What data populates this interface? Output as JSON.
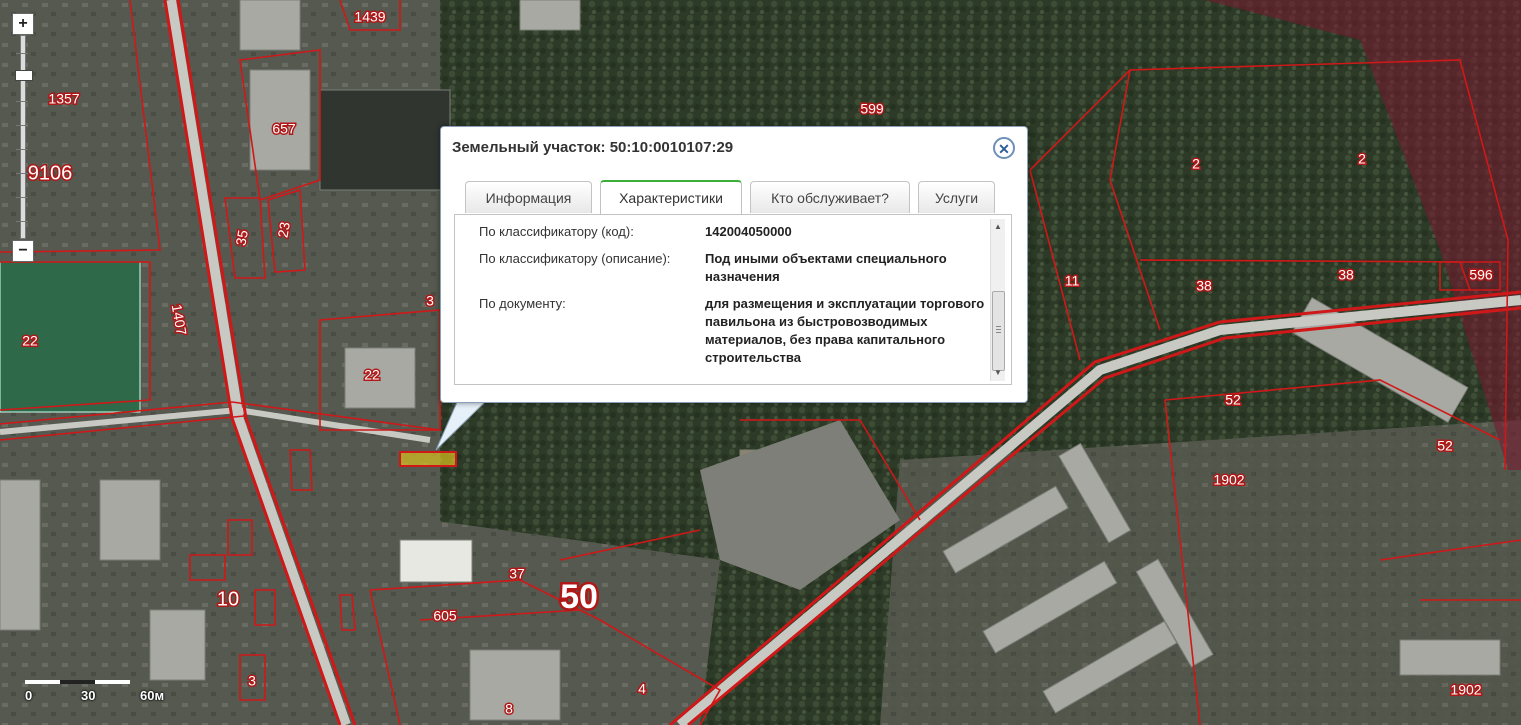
{
  "map": {
    "parcel_labels": [
      "1439",
      "1357",
      "657",
      "9106",
      "35",
      "23",
      "22",
      "1407",
      "3",
      "22",
      "599",
      "2",
      "2",
      "11",
      "38",
      "38",
      "596",
      "52",
      "52",
      "1902",
      "10",
      "37",
      "605",
      "4",
      "8",
      "1902"
    ],
    "district_label": "50",
    "parcel_outline_color": "#d01818",
    "highlight_color": "#e8d020"
  },
  "zoom": {
    "plus_label": "+",
    "minus_label": "−"
  },
  "scale": {
    "labels": [
      "0",
      "30",
      "60м"
    ]
  },
  "popup": {
    "title": "Земельный участок: 50:10:0010107:29",
    "close_icon": "close-icon",
    "tabs": [
      {
        "label": "Информация"
      },
      {
        "label": "Характеристики",
        "active": true
      },
      {
        "label": "Кто обслуживает?"
      },
      {
        "label": "Услуги"
      }
    ],
    "rows": [
      {
        "label": "По классификатору (код):",
        "value": "142004050000"
      },
      {
        "label": "По классификатору (описание):",
        "value": "Под иными объектами специального назначения"
      },
      {
        "label": "По документу:",
        "value": "для размещения и эксплуатации торгового павильона из быстровозводимых материалов, без права капитального строительства"
      }
    ],
    "accent_color": "#3cae3c"
  }
}
